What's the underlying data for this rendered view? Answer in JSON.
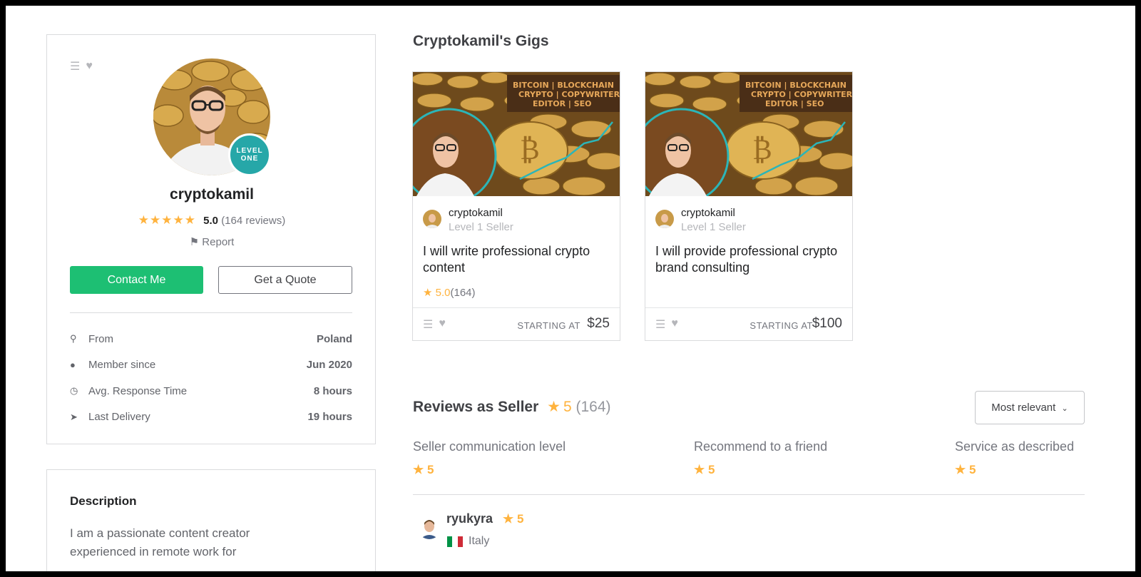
{
  "profile": {
    "username": "cryptokamil",
    "level_badge": "LEVEL ONE",
    "stars": "★★★★★",
    "rating": "5.0",
    "reviews": "(164 reviews)",
    "report": "Report",
    "contact_label": "Contact Me",
    "quote_label": "Get a Quote",
    "stats": [
      {
        "icon": "location-pin-icon",
        "label": "From",
        "value": "Poland"
      },
      {
        "icon": "user-icon",
        "label": "Member since",
        "value": "Jun 2020"
      },
      {
        "icon": "clock-icon",
        "label": "Avg. Response Time",
        "value": "8 hours"
      },
      {
        "icon": "paper-plane-icon",
        "label": "Last Delivery",
        "value": "19 hours"
      }
    ]
  },
  "description": {
    "title": "Description",
    "text": "I am a passionate content creator experienced in remote work for"
  },
  "gigs": {
    "title": "Cryptokamil's Gigs",
    "image_text": "BITCOIN | BLOCKCHAIN CRYPTO | COPYWRITER EDITOR | SEO",
    "items": [
      {
        "seller": "cryptokamil",
        "level": "Level 1 Seller",
        "title": "I will write professional crypto content",
        "rating": "5.0",
        "count": "(164)",
        "price_label": "STARTING AT",
        "price": "$25"
      },
      {
        "seller": "cryptokamil",
        "level": "Level 1 Seller",
        "title": "I will provide professional crypto brand consulting",
        "rating": "",
        "count": "",
        "price_label": "STARTING AT",
        "price": "$100"
      }
    ]
  },
  "reviews": {
    "title": "Reviews as Seller",
    "score": "5",
    "count": "(164)",
    "sort_label": "Most relevant",
    "criteria": [
      {
        "label": "Seller communication level",
        "score": "5"
      },
      {
        "label": "Recommend to a friend",
        "score": "5"
      },
      {
        "label": "Service as described",
        "score": "5"
      }
    ],
    "first": {
      "name": "ryukyra",
      "score": "5",
      "country": "Italy"
    }
  },
  "colors": {
    "accent": "#1dbf73",
    "star": "#ffb33e",
    "badge": "#26a7a8"
  }
}
